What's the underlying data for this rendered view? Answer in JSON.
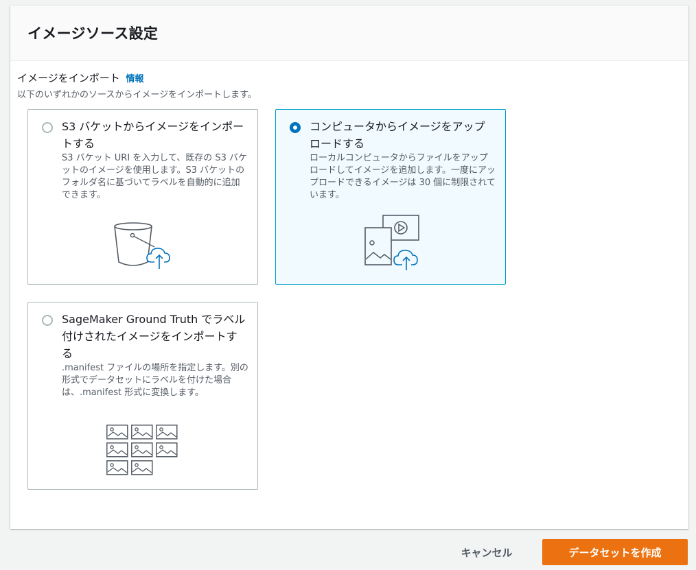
{
  "panel": {
    "title": "イメージソース設定"
  },
  "import_section": {
    "label": "イメージをインポート",
    "info_link": "情報",
    "description": "以下のいずれかのソースからイメージをインポートします。"
  },
  "options": [
    {
      "title": "S3 バケットからイメージをインポートする",
      "description": "S3 バケット URI を入力して、既存の S3 バケットのイメージを使用します。S3 バケットのフォルダ名に基づいてラベルを自動的に追加できます。",
      "selected": false,
      "icon": "s3-bucket-upload-icon"
    },
    {
      "title": "コンピュータからイメージをアップロードする",
      "description": "ローカルコンピュータからファイルをアップロードしてイメージを追加します。一度にアップロードできるイメージは 30 個に制限されています。",
      "selected": true,
      "icon": "computer-upload-icon"
    },
    {
      "title": "SageMaker Ground Truth でラベル付けされたイメージをインポートする",
      "description": ".manifest ファイルの場所を指定します。別の形式でデータセットにラベルを付けた場合は、.manifest 形式に変換します。",
      "selected": false,
      "icon": "image-grid-icon"
    }
  ],
  "footer": {
    "cancel_label": "キャンセル",
    "create_label": "データセットを作成"
  },
  "colors": {
    "accent": "#0073bb",
    "selected_border": "#00a1c9",
    "selected_bg": "#f1faff",
    "primary_button": "#ec7211",
    "icon_blue": "#0073bb",
    "icon_gray": "#545b64"
  }
}
